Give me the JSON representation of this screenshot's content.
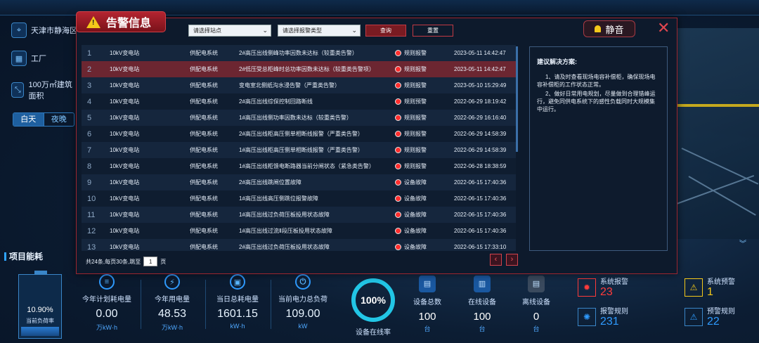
{
  "left": {
    "location": "天津市静海区",
    "factory": "工厂",
    "area": "100万㎡建筑面积",
    "toggle_day": "白天",
    "toggle_night": "夜晚"
  },
  "energy_title": "项目能耗",
  "battery": {
    "value": "10.90%",
    "label": "当前负荷率",
    "fill_fraction": 0.15
  },
  "metrics": [
    {
      "label": "今年计划耗电量",
      "value": "0.00",
      "unit": "万kW·h"
    },
    {
      "label": "今年用电量",
      "value": "48.53",
      "unit": "万kW·h"
    },
    {
      "label": "当日总耗电量",
      "value": "1601.15",
      "unit": "kW·h"
    },
    {
      "label": "当前电力总负荷",
      "value": "109.00",
      "unit": "kW"
    }
  ],
  "online_rate": {
    "value": "100%",
    "label": "设备在线率"
  },
  "devices": [
    {
      "label": "设备总数",
      "value": "100",
      "unit": "台"
    },
    {
      "label": "在线设备",
      "value": "100",
      "unit": "台"
    },
    {
      "label": "离线设备",
      "value": "0",
      "unit": "台"
    }
  ],
  "alarms": [
    {
      "label": "系统报警",
      "value": "23",
      "color": "#ff3b3b"
    },
    {
      "label": "系统预警",
      "value": "1",
      "color": "#f4c81a"
    },
    {
      "label": "报警规则",
      "value": "231",
      "color": "#2f9bff"
    },
    {
      "label": "预警规则",
      "value": "22",
      "color": "#2f9bff"
    }
  ],
  "modal": {
    "title": "告警信息",
    "site_select": "请选择站点",
    "type_select": "请选择报警类型",
    "query": "查询",
    "reset": "重置",
    "sound": "静音",
    "close": "✕",
    "rows": [
      {
        "no": "1",
        "station": "10kV变电站",
        "system": "供配电系统",
        "desc": "2#高压出线侧峰功率因数未达标（较重类告警）",
        "type": "规则报警",
        "time": "2023-05-11 14:42:47"
      },
      {
        "no": "2",
        "station": "10kV变电站",
        "system": "供配电系统",
        "desc": "2#低压受总柜峰时总功率因数未达标（较重类告警项）",
        "type": "规则报警",
        "time": "2023-05-11 14:42:47"
      },
      {
        "no": "3",
        "station": "10kV变电站",
        "system": "供配电系统",
        "desc": "变电室北侧纸沟水浸告警（严重类告警）",
        "type": "规则报警",
        "time": "2023-05-10 15:29:49"
      },
      {
        "no": "4",
        "station": "10kV变电站",
        "system": "供配电系统",
        "desc": "2#高压出线综保控制回路断线",
        "type": "规则预警",
        "time": "2022-06-29 18:19:42"
      },
      {
        "no": "5",
        "station": "10kV变电站",
        "system": "供配电系统",
        "desc": "1#高压出线侧功率因数未达标（较重类告警）",
        "type": "规则报警",
        "time": "2022-06-29 16:16:40"
      },
      {
        "no": "6",
        "station": "10kV变电站",
        "system": "供配电系统",
        "desc": "2#高压出线柜高压侧单相断线报警（严重类告警）",
        "type": "规则报警",
        "time": "2022-06-29 14:58:39"
      },
      {
        "no": "7",
        "station": "10kV变电站",
        "system": "供配电系统",
        "desc": "1#高压出线柜高压侧单相断线报警（严重类告警）",
        "type": "规则报警",
        "time": "2022-06-29 14:58:39"
      },
      {
        "no": "8",
        "station": "10kV变电站",
        "system": "供配电系统",
        "desc": "1#高压出线柜馈电断路器当前分闸状态（紧急类告警）",
        "type": "规则报警",
        "time": "2022-06-28 18:38:59"
      },
      {
        "no": "9",
        "station": "10kV变电站",
        "system": "供配电系统",
        "desc": "2#高压出线跳闸位置故障",
        "type": "设备故障",
        "time": "2022-06-15 17:40:36"
      },
      {
        "no": "10",
        "station": "10kV变电站",
        "system": "供配电系统",
        "desc": "1#高压出线高压侧跳位报警故障",
        "type": "设备故障",
        "time": "2022-06-15 17:40:36"
      },
      {
        "no": "11",
        "station": "10kV变电站",
        "system": "供配电系统",
        "desc": "1#高压出线过负荷压板投用状态故障",
        "type": "设备故障",
        "time": "2022-06-15 17:40:36"
      },
      {
        "no": "12",
        "station": "10kV变电站",
        "system": "供配电系统",
        "desc": "1#高压出线过流Ⅱ段压板投用状态故障",
        "type": "设备故障",
        "time": "2022-06-15 17:40:36"
      },
      {
        "no": "13",
        "station": "10kV变电站",
        "system": "供配电系统",
        "desc": "2#高压出线过负荷压板投用状态故障",
        "type": "设备故障",
        "time": "2022-06-15 17:33:10"
      }
    ],
    "pager_text": "共24条,每页30条,跳至",
    "pager_page": "1",
    "pager_suffix": "页",
    "advice_title": "建议解决方案:",
    "advice_1": "1、请及时查看现场电容补偿柜，确保现场电容补偿柜的工作状态正常。",
    "advice_2": "2、做好日常用电规划，尽量做到合理错峰运行，避免同供电系统下的感性负载同时大规模集中运行。"
  }
}
